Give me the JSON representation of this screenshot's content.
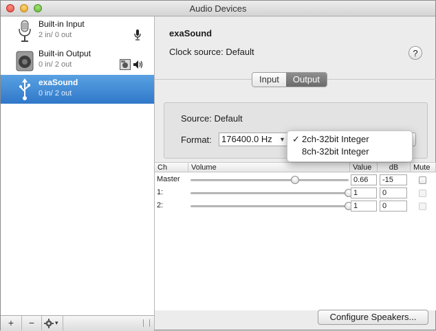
{
  "window": {
    "title": "Audio Devices"
  },
  "sidebar": {
    "devices": [
      {
        "name": "Built-in Input",
        "sub": "2 in/ 0 out",
        "icon": "microphone-icon",
        "selected": false
      },
      {
        "name": "Built-in Output",
        "sub": "0 in/ 2 out",
        "icon": "speaker-icon",
        "selected": false
      },
      {
        "name": "exaSound",
        "sub": "0 in/ 2 out",
        "icon": "usb-icon",
        "selected": true
      }
    ],
    "bottom": {
      "add": "+",
      "remove": "−",
      "gear_arrow": "▾"
    }
  },
  "detail": {
    "device_name": "exaSound",
    "clock_source_label": "Clock source:",
    "clock_source_value": "Default",
    "help": "?",
    "tabs": [
      "Input",
      "Output"
    ],
    "active_tab": "Output",
    "source_label": "Source:",
    "source_value": "Default",
    "format_label": "Format:",
    "format_value": "176400.0 Hz",
    "format_menu": [
      {
        "label": "2ch-32bit Integer",
        "checked": true
      },
      {
        "label": "8ch-32bit Integer",
        "checked": false
      }
    ],
    "check_mark": "✓"
  },
  "table": {
    "headers": {
      "ch": "Ch",
      "volume": "Volume",
      "value": "Value",
      "db": "dB",
      "mute": "Mute"
    },
    "rows": [
      {
        "ch": "Master",
        "level": 0.66,
        "value": "0.66",
        "db": "-15",
        "mute_enabled": true
      },
      {
        "ch": "1:",
        "level": 1.0,
        "value": "1",
        "db": "0",
        "mute_enabled": false
      },
      {
        "ch": "2:",
        "level": 1.0,
        "value": "1",
        "db": "0",
        "mute_enabled": false
      }
    ]
  },
  "footer": {
    "configure_label": "Configure Speakers..."
  }
}
